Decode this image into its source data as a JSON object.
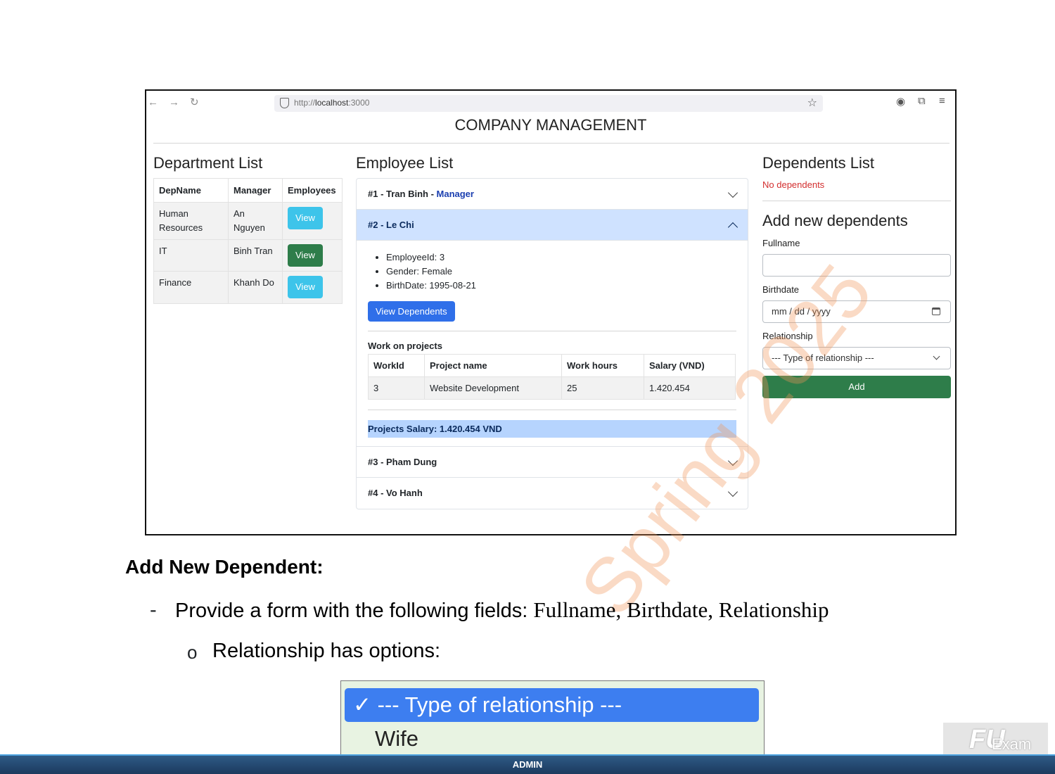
{
  "browser": {
    "url_prefix": "http://",
    "url_host": "localhost",
    "url_port": ":3000"
  },
  "app": {
    "title": "COMPANY MANAGEMENT"
  },
  "departments": {
    "title": "Department List",
    "headers": [
      "DepName",
      "Manager",
      "Employees"
    ],
    "rows": [
      {
        "name": "Human Resources",
        "manager": "An Nguyen",
        "action": "View"
      },
      {
        "name": "IT",
        "manager": "Binh Tran",
        "action": "View"
      },
      {
        "name": "Finance",
        "manager": "Khanh Do",
        "action": "View"
      }
    ]
  },
  "employees": {
    "title": "Employee List",
    "items": [
      {
        "label": "#1 - Tran Binh - ",
        "role": "Manager"
      },
      {
        "label": "#2 - Le Chi"
      },
      {
        "label": "#3 - Pham Dung"
      },
      {
        "label": "#4 - Vo Hanh"
      }
    ],
    "details": [
      "EmployeeId: 3",
      "Gender: Female",
      "BirthDate: 1995-08-21"
    ],
    "view_dependents": "View Dependents",
    "projects_title": "Work on projects",
    "project_headers": [
      "WorkId",
      "Project name",
      "Work hours",
      "Salary (VND)"
    ],
    "project_rows": [
      [
        "3",
        "Website Development",
        "25",
        "1.420.454"
      ]
    ],
    "projects_salary": "Projects Salary: 1.420.454 VND"
  },
  "dependents": {
    "title": "Dependents List",
    "empty": "No dependents",
    "form_title": "Add new dependents",
    "fullname_label": "Fullname",
    "birthdate_label": "Birthdate",
    "birthdate_placeholder": "mm / dd / yyyy",
    "relationship_label": "Relationship",
    "relationship_value": "--- Type of relationship ---",
    "add_label": "Add"
  },
  "doc": {
    "heading": "Add New Dependent:",
    "dash": "-",
    "line1_text": "Provide a form with the following fields: ",
    "line1_fields": "Fullname, Birthdate, Relationship",
    "bullet": "o",
    "line2_text": "Relationship has options:",
    "options": [
      "--- Type of relationship ---",
      "Wife"
    ],
    "check": "✓"
  },
  "watermark": "Spring 2025",
  "footer": "ADMIN",
  "logo": {
    "brand": "FU",
    "sub": "Exam"
  }
}
